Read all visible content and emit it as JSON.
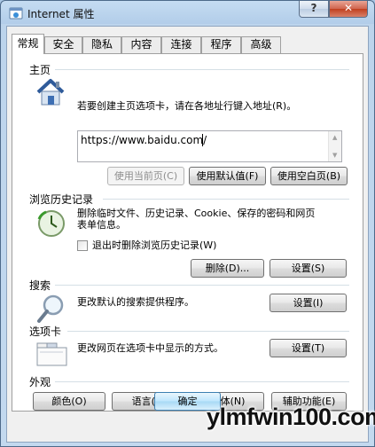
{
  "window": {
    "title": "Internet 属性",
    "help_label": "?",
    "close_label": "✕"
  },
  "tabs": [
    {
      "label": "常规",
      "active": true
    },
    {
      "label": "安全",
      "active": false
    },
    {
      "label": "隐私",
      "active": false
    },
    {
      "label": "内容",
      "active": false
    },
    {
      "label": "连接",
      "active": false
    },
    {
      "label": "程序",
      "active": false
    },
    {
      "label": "高级",
      "active": false
    }
  ],
  "home": {
    "title": "主页",
    "description": "若要创建主页选项卡，请在各地址行键入地址(R)。",
    "url_value": "https://www.baidu.com/",
    "use_current_label": "使用当前页(C)",
    "use_default_label": "使用默认值(F)",
    "use_blank_label": "使用空白页(B)"
  },
  "history": {
    "title": "浏览历史记录",
    "description_line1": "删除临时文件、历史记录、Cookie、保存的密码和网页",
    "description_line2": "表单信息。",
    "checkbox_label": "退出时删除浏览历史记录(W)",
    "checkbox_checked": false,
    "delete_label": "删除(D)...",
    "settings_label": "设置(S)"
  },
  "search": {
    "title": "搜索",
    "description": "更改默认的搜索提供程序。",
    "settings_label": "设置(I)"
  },
  "tabs_section": {
    "title": "选项卡",
    "description": "更改网页在选项卡中显示的方式。",
    "settings_label": "设置(T)"
  },
  "appearance": {
    "title": "外观",
    "colors_label": "颜色(O)",
    "languages_label": "语言(L)",
    "fonts_label": "字体(N)",
    "accessibility_label": "辅助功能(E)"
  },
  "footer": {
    "ok_label": "确定"
  },
  "watermark": "ylmfwin100.com"
}
